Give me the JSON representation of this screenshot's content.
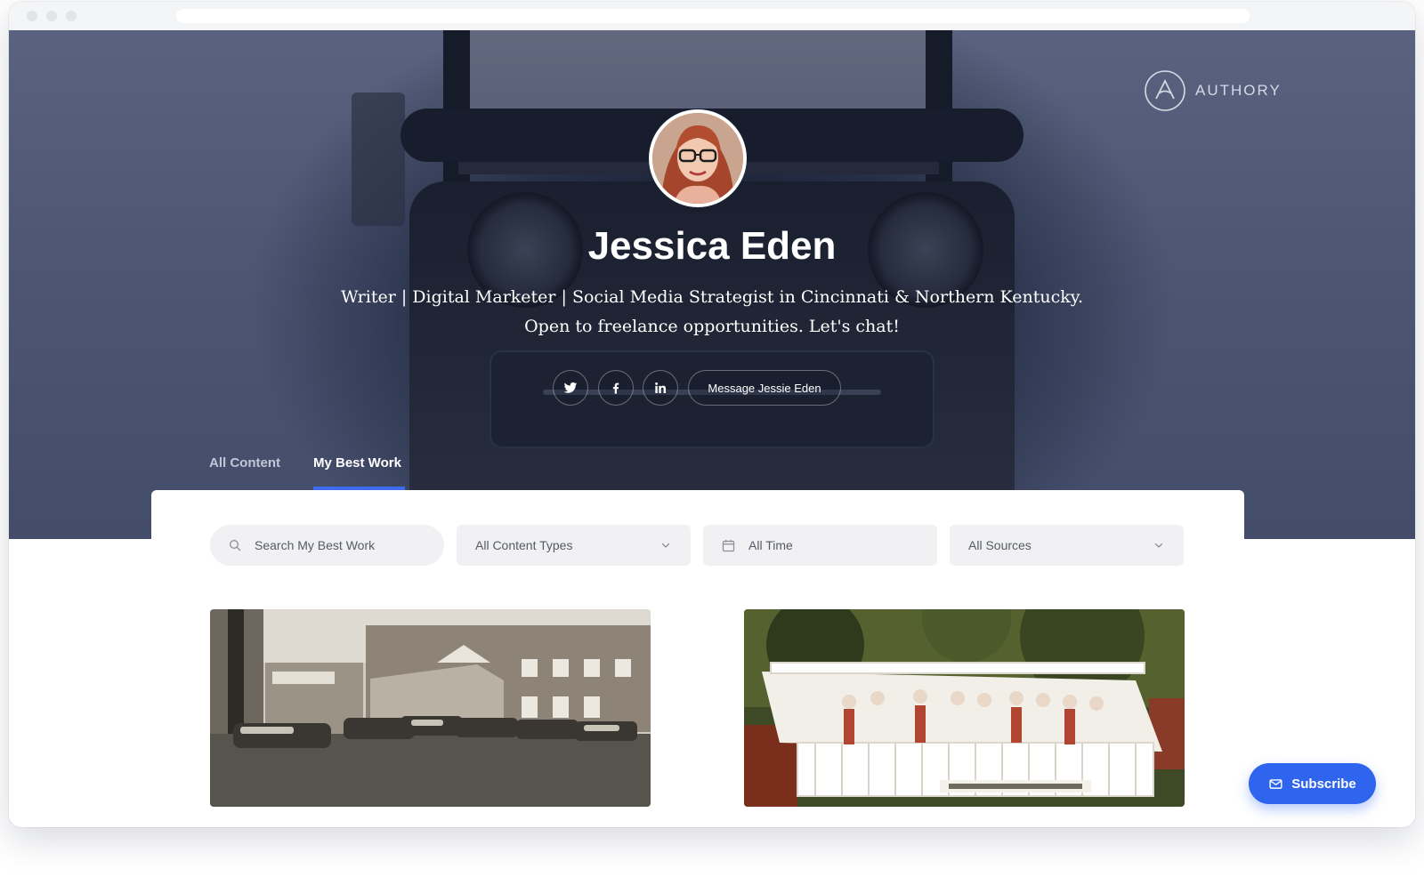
{
  "brand": {
    "name": "AUTHORY"
  },
  "profile": {
    "name": "Jessica Eden",
    "bio_line1": "Writer | Digital Marketer | Social Media Strategist in Cincinnati & Northern Kentucky.",
    "bio_line2": "Open to freelance opportunities. Let's chat!"
  },
  "social": [
    "twitter-icon",
    "facebook-icon",
    "linkedin-icon"
  ],
  "message_label": "Message Jessie Eden",
  "tabs": [
    {
      "label": "All Content",
      "active": false
    },
    {
      "label": "My Best Work",
      "active": true
    }
  ],
  "filters": {
    "search_placeholder": "Search My Best Work",
    "content_types": "All Content Types",
    "time": "All Time",
    "sources": "All Sources"
  },
  "subscribe_label": "Subscribe",
  "colors": {
    "accent": "#2f64ef",
    "hero": "#4d5673"
  }
}
